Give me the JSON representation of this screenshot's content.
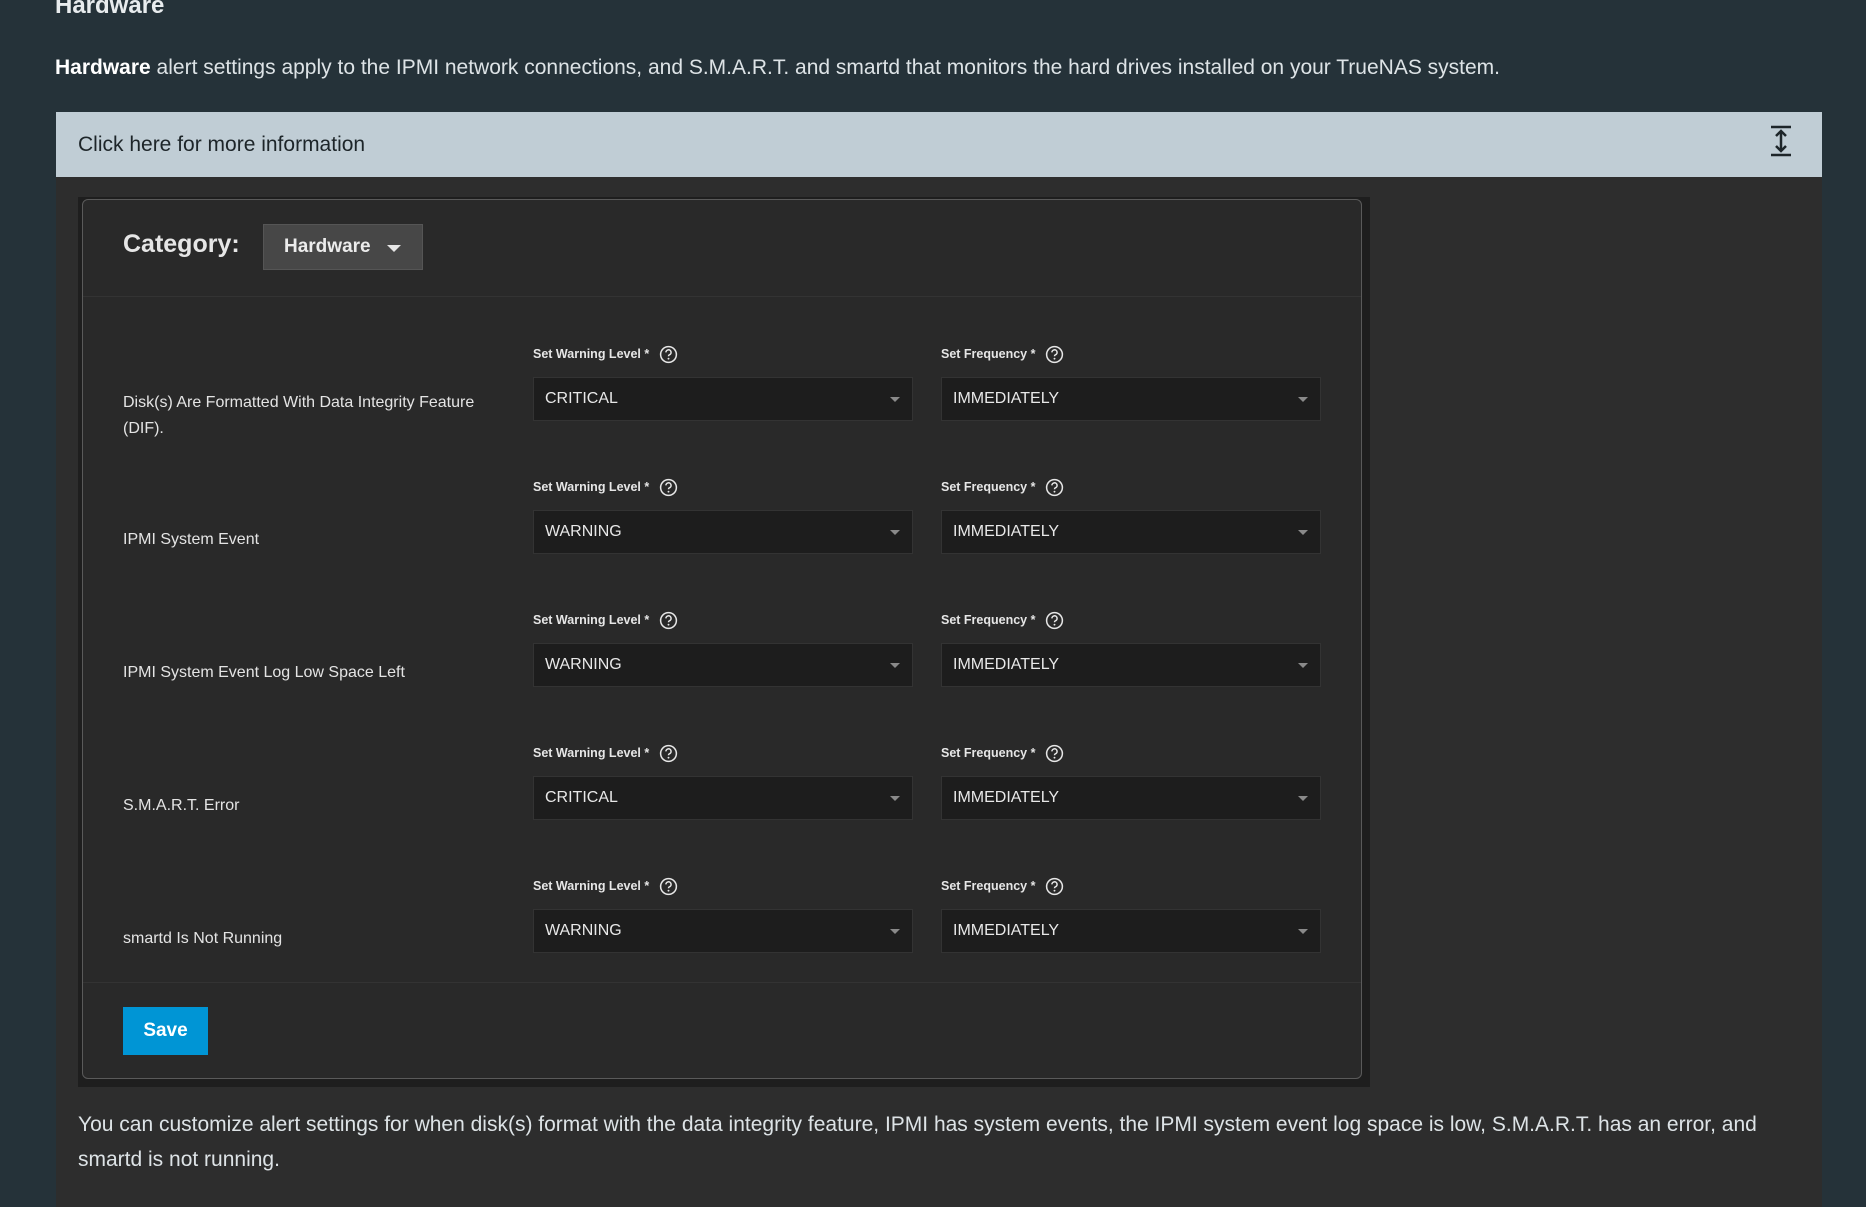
{
  "section": {
    "title": "Hardware",
    "intro_bold": "Hardware",
    "intro_rest": " alert settings apply to the IPMI network connections, and S.M.A.R.T. and smartd that monitors the hard drives installed on your TrueNAS system."
  },
  "expander": {
    "label": "Click here for more information",
    "icon": "expand-vertical-icon"
  },
  "alert_card": {
    "category_label": "Category:",
    "category_value": "Hardware",
    "warning_label": "Set Warning Level *",
    "frequency_label": "Set Frequency *",
    "rows": [
      {
        "name": "Disk(s) Are Formatted With Data Integrity Feature (DIF).",
        "level": "CRITICAL",
        "frequency": "IMMEDIATELY"
      },
      {
        "name": "IPMI System Event",
        "level": "WARNING",
        "frequency": "IMMEDIATELY"
      },
      {
        "name": "IPMI System Event Log Low Space Left",
        "level": "WARNING",
        "frequency": "IMMEDIATELY"
      },
      {
        "name": "S.M.A.R.T. Error",
        "level": "CRITICAL",
        "frequency": "IMMEDIATELY"
      },
      {
        "name": "smartd Is Not Running",
        "level": "WARNING",
        "frequency": "IMMEDIATELY"
      }
    ],
    "save_label": "Save"
  },
  "outro": "You can customize alert settings for when disk(s) format with the data integrity feature, IPMI has system events, the IPMI system event log space is low, S.M.A.R.T. has an error, and smartd is not running.",
  "colors": {
    "page_bg": "#253239",
    "expander_bg": "#c0cdd5",
    "card_bg": "#292929",
    "accent": "#0095d5"
  }
}
